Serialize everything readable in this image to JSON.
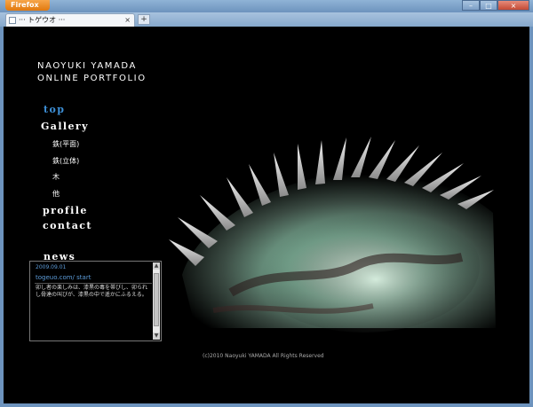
{
  "browser": {
    "menu_button": "Firefox",
    "tab_title": "··· トゲウオ ···",
    "tab_close": "×",
    "new_tab": "+",
    "controls": {
      "minimize": "–",
      "maximize": "□",
      "close": "×"
    }
  },
  "site": {
    "title_line1": "NAOYUKI YAMADA",
    "title_line2": "ONLINE PORTFOLIO"
  },
  "nav": {
    "top": "top",
    "gallery": "Gallery",
    "gallery_sub": [
      "鉄(平面)",
      "鉄(立体)",
      "木",
      "他"
    ],
    "profile": "profile",
    "contact": "contact",
    "news": "news"
  },
  "news": {
    "date": "2009.09.01",
    "link": "togeuo.com/ start",
    "text": "卯し者の楽しみは、漆黒の毒を帯びし、卯られし骨達の叫びが、漆黒の中で遥かにふるえる。"
  },
  "footer": {
    "copyright": "(c)2010 Naoyuki YAMADA All Rights Reserved"
  },
  "colors": {
    "background": "#000000",
    "accent": "#3d8fd6"
  }
}
